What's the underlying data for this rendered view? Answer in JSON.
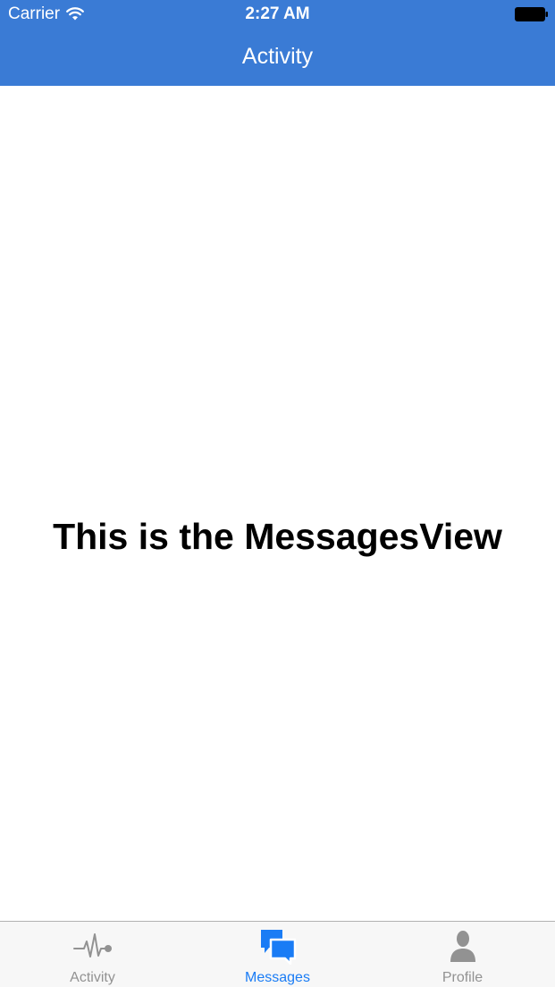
{
  "status_bar": {
    "carrier": "Carrier",
    "time": "2:27 AM"
  },
  "nav_bar": {
    "title": "Activity",
    "background_color": "#3a7bd5"
  },
  "content": {
    "message": "This is the MessagesView"
  },
  "tab_bar": {
    "active_color": "#1a7cf5",
    "inactive_color": "#929292",
    "tabs": [
      {
        "label": "Activity",
        "icon": "activity-pulse-icon",
        "active": false
      },
      {
        "label": "Messages",
        "icon": "chat-bubbles-icon",
        "active": true
      },
      {
        "label": "Profile",
        "icon": "person-icon",
        "active": false
      }
    ]
  }
}
